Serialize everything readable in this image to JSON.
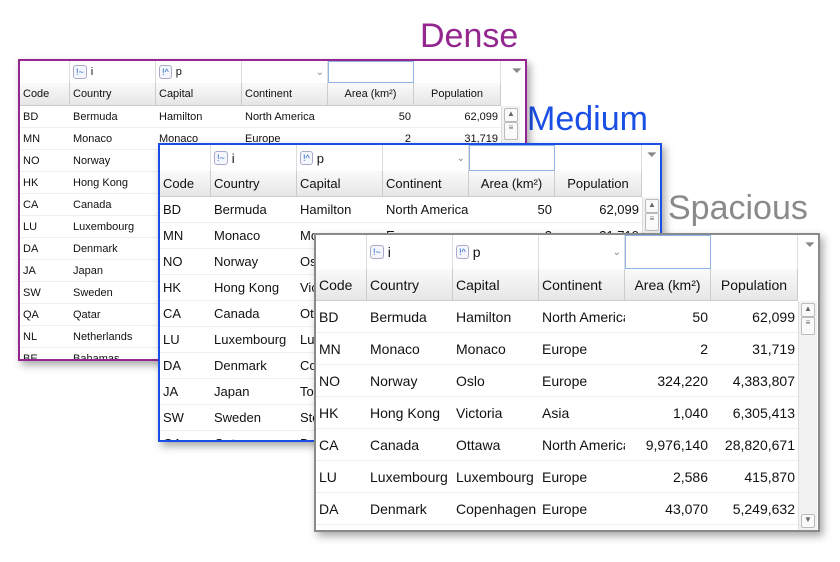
{
  "titles": {
    "dense": "Dense",
    "medium": "Medium",
    "spacious": "Spacious"
  },
  "colors": {
    "dense": "#93278f",
    "medium": "#1a4fe6",
    "spacious": "#8a8a8a"
  },
  "filters": {
    "country": "i",
    "capital": "p",
    "country_icon": "contains-operator-icon",
    "capital_icon": "starts-with-operator-icon"
  },
  "columns": [
    "Code",
    "Country",
    "Capital",
    "Continent",
    "Area (km²)",
    "Population"
  ],
  "rows": [
    [
      "BD",
      "Bermuda",
      "Hamilton",
      "North America",
      "50",
      "62,099"
    ],
    [
      "MN",
      "Monaco",
      "Monaco",
      "Europe",
      "2",
      "31,719"
    ],
    [
      "NO",
      "Norway",
      "Oslo",
      "Europe",
      "324,220",
      "4,383,807"
    ],
    [
      "HK",
      "Hong Kong",
      "Victoria",
      "Asia",
      "1,040",
      "6,305,413"
    ],
    [
      "CA",
      "Canada",
      "Ottawa",
      "North America",
      "9,976,140",
      "28,820,671"
    ],
    [
      "LU",
      "Luxembourg",
      "Luxembourg",
      "Europe",
      "2,586",
      "415,870"
    ],
    [
      "DA",
      "Denmark",
      "Copenhagen",
      "Europe",
      "43,070",
      "5,249,632"
    ],
    [
      "JA",
      "Japan",
      "Tokyo",
      "",
      "",
      ""
    ],
    [
      "SW",
      "Sweden",
      "Stockholm",
      "",
      "",
      ""
    ],
    [
      "QA",
      "Qatar",
      "Doha",
      "",
      "",
      ""
    ],
    [
      "NL",
      "Netherlands",
      "",
      "",
      "",
      ""
    ],
    [
      "BE",
      "Bahamas",
      "",
      "",
      "",
      ""
    ]
  ]
}
